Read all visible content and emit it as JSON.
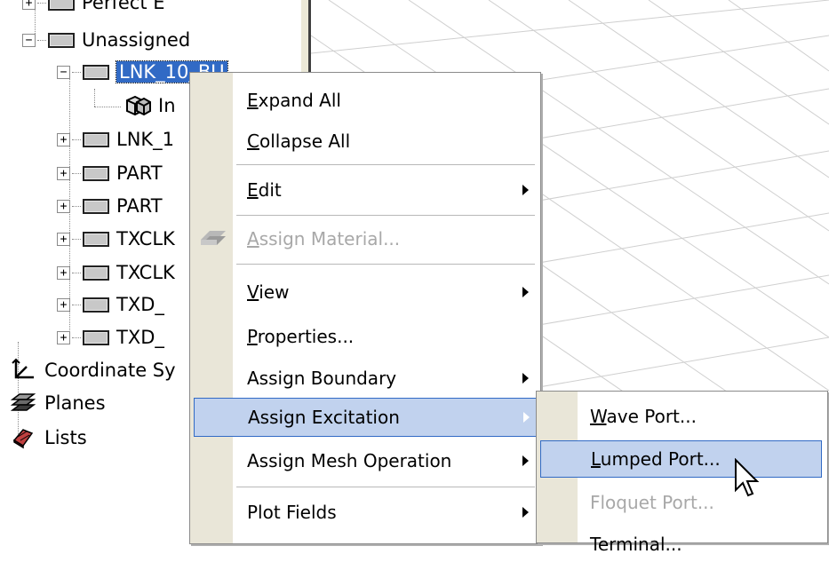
{
  "tree": {
    "items": [
      {
        "label": "Perfect E",
        "expander": "+"
      },
      {
        "label": "Unassigned",
        "expander": "−"
      },
      {
        "label": "LNK_10_BU",
        "expander": "−"
      },
      {
        "label": "In"
      },
      {
        "label": "LNK_1",
        "expander": "+"
      },
      {
        "label": "PART",
        "expander": "+"
      },
      {
        "label": "PART",
        "expander": "+"
      },
      {
        "label": "TXCLK",
        "expander": "+"
      },
      {
        "label": "TXCLK",
        "expander": "+"
      },
      {
        "label": "TXD_",
        "expander": "+"
      },
      {
        "label": "TXD_",
        "expander": "+"
      },
      {
        "label": "Coordinate Sy"
      },
      {
        "label": "Planes"
      },
      {
        "label": "Lists"
      }
    ]
  },
  "context_menu": {
    "items": [
      {
        "label": "Expand All",
        "mnemonic": "E",
        "rest": "xpand All"
      },
      {
        "label": "Collapse All",
        "mnemonic": "C",
        "rest": "ollapse All"
      },
      {
        "label": "Edit",
        "mnemonic": "E",
        "rest": "dit",
        "submenu": true
      },
      {
        "label": "Assign Material...",
        "mnemonic": "A",
        "rest": "ssign Material...",
        "disabled": true
      },
      {
        "label": "View",
        "mnemonic": "V",
        "rest": "iew",
        "submenu": true
      },
      {
        "label": "Properties...",
        "mnemonic": "P",
        "rest": "roperties..."
      },
      {
        "label": "Assign Boundary",
        "submenu": true
      },
      {
        "label": "Assign Excitation",
        "submenu": true,
        "highlighted": true
      },
      {
        "label": "Assign Mesh Operation",
        "submenu": true
      },
      {
        "label": "Plot Fields",
        "submenu": true
      }
    ]
  },
  "submenu": {
    "items": [
      {
        "label": "Wave Port...",
        "mnemonic": "W",
        "rest": "ave Port..."
      },
      {
        "label": "Lumped Port...",
        "mnemonic": "L",
        "rest": "umped Port...",
        "highlighted": true
      },
      {
        "label": "Floquet Port...",
        "disabled": true
      },
      {
        "label": "Terminal..."
      }
    ]
  },
  "colors": {
    "selection": "#316ac5",
    "menu_highlight": "#c1d2ee",
    "menu_gutter": "#e9e6d8",
    "grid_line": "#c9c9c9"
  }
}
